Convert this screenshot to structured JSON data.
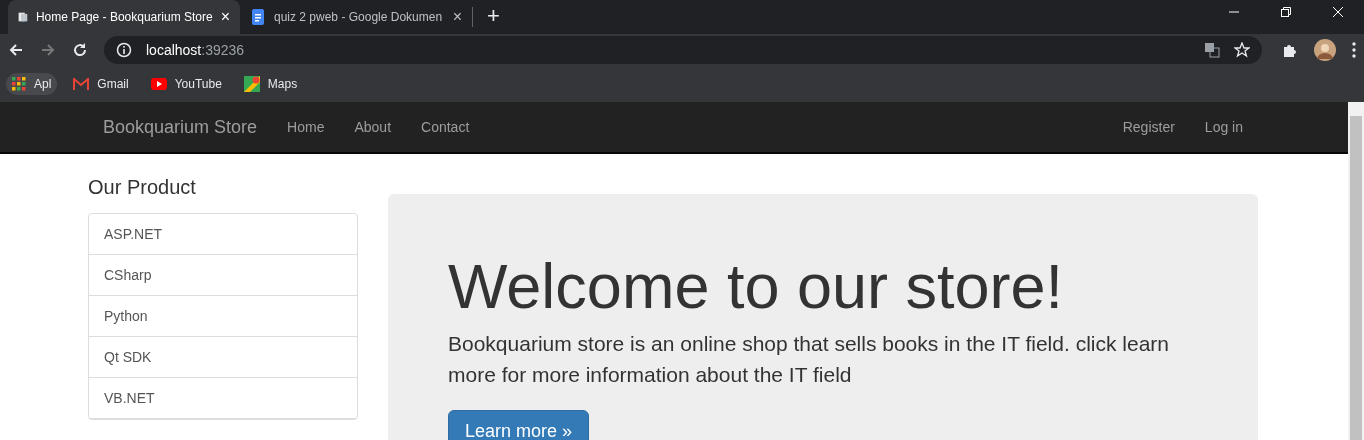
{
  "browser": {
    "tabs": [
      {
        "title": "Home Page - Bookquarium Store",
        "selected": true,
        "close": "×"
      },
      {
        "title": "quiz 2 pweb - Google Dokumen",
        "selected": false,
        "close": "×"
      }
    ],
    "new_tab": "+",
    "address": {
      "host": "localhost",
      "port": ":39236"
    },
    "bookmarks": [
      {
        "label": "Apl",
        "kind": "apps"
      },
      {
        "label": "Gmail",
        "kind": "gmail"
      },
      {
        "label": "YouTube",
        "kind": "youtube"
      },
      {
        "label": "Maps",
        "kind": "maps"
      }
    ]
  },
  "navbar": {
    "brand": "Bookquarium Store",
    "links": [
      "Home",
      "About",
      "Contact"
    ],
    "right_links": [
      "Register",
      "Log in"
    ]
  },
  "sidebar": {
    "title": "Our Product",
    "items": [
      "ASP.NET",
      "CSharp",
      "Python",
      "Qt SDK",
      "VB.NET"
    ]
  },
  "hero": {
    "title": "Welcome to our store!",
    "text": "Bookquarium store is an online shop that sells books in the IT field. click learn more for more information about the IT field",
    "button": "Learn more »"
  }
}
